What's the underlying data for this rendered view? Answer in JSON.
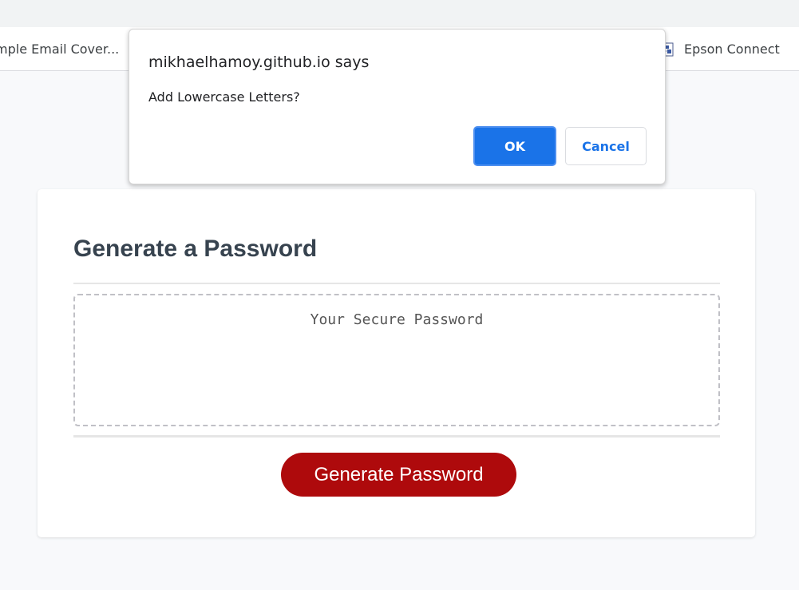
{
  "bookmarks": {
    "left_label": "mple Email Cover...",
    "right_label": "Epson Connect",
    "right_icon": "epson-icon"
  },
  "dialog": {
    "title": "mikhaelhamoy.github.io says",
    "message": "Add Lowercase Letters?",
    "ok_label": "OK",
    "cancel_label": "Cancel"
  },
  "card": {
    "title": "Generate a Password",
    "password_placeholder": "Your Secure Password",
    "password_value": "",
    "generate_label": "Generate Password"
  },
  "colors": {
    "accent_red": "#ae0a0c",
    "dialog_primary": "#1a73e8",
    "title_text": "#37434f"
  }
}
